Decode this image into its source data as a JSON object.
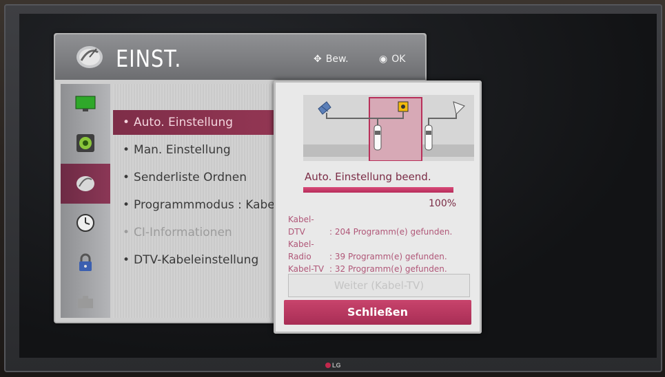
{
  "header": {
    "title": "EINST.",
    "hint_move": "Bew.",
    "hint_ok": "OK",
    "icon": "satellite-icon"
  },
  "sidebar": {
    "items": [
      {
        "icon": "picture-icon"
      },
      {
        "icon": "audio-icon"
      },
      {
        "icon": "satellite-icon",
        "active": true
      },
      {
        "icon": "clock-icon"
      },
      {
        "icon": "lock-icon"
      },
      {
        "icon": "options-icon"
      }
    ]
  },
  "menu": {
    "items": [
      {
        "label": "Auto. Einstellung",
        "active": true
      },
      {
        "label": "Man. Einstellung"
      },
      {
        "label": "Senderliste Ordnen"
      },
      {
        "label": "Programmmodus : Kabe"
      },
      {
        "label": "CI-Informationen",
        "disabled": true
      },
      {
        "label": "DTV-Kabeleinstellung"
      }
    ]
  },
  "dialog": {
    "status": "Auto. Einstellung beend.",
    "progress": 100,
    "percent_label": "100%",
    "results": [
      {
        "label": "Kabel-DTV",
        "value": ": 204 Programm(e) gefunden."
      },
      {
        "label": "Kabel-Radio",
        "value": ": 39 Programm(e) gefunden."
      },
      {
        "label": "Kabel-TV",
        "value": ": 32 Programm(e) gefunden."
      }
    ],
    "next_button": "Weiter (Kabel-TV)",
    "close_button": "Schließen"
  },
  "brand": "LG",
  "colors": {
    "accent": "#b72c5a",
    "active_menu": "#8b3756"
  }
}
